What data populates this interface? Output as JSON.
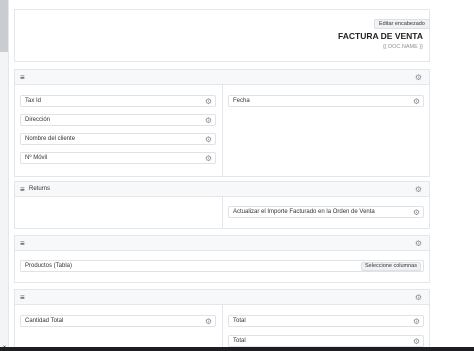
{
  "header": {
    "edit_button": "Editar encabezado",
    "doc_title": "FACTURA DE VENTA",
    "doc_name": "{{ DOC.NAME }}"
  },
  "icons": {
    "hamburger": "menu-icon",
    "gear": "gear-icon"
  },
  "sections": {
    "s1": {
      "fields_left": [
        "Tax Id",
        "Dirección",
        "Nombre del cliente",
        "Nº Móvil"
      ],
      "field_right": "Fecha"
    },
    "s2": {
      "title": "Returns",
      "field_right": "Actualizar el Importe Facturado en la Orden de Venta"
    },
    "s3": {
      "table_field": "Productos (Tabla)",
      "select_columns": "Seleccione columnas"
    },
    "s4": {
      "field_left": "Cantidad Total",
      "fields_right": [
        "Total",
        "Total"
      ]
    }
  }
}
